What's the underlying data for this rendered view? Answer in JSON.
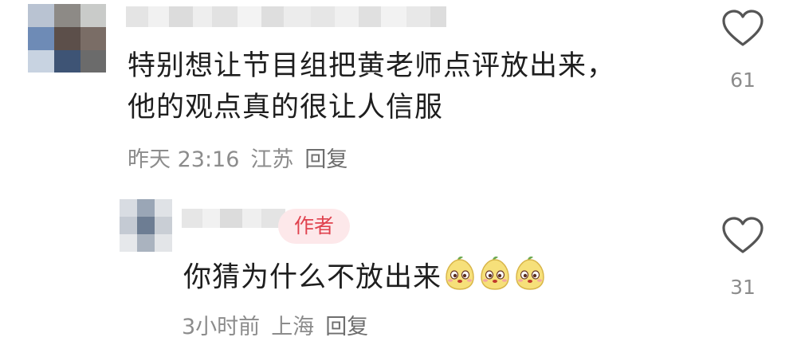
{
  "comments": [
    {
      "text_lines": [
        "特别想让节目组把黄老师点评放出来，",
        "他的观点真的很让人信服"
      ],
      "time": "昨天 23:16",
      "location": "江苏",
      "reply_label": "回复",
      "like_count": "61",
      "like_icon": "heart-outline-icon"
    },
    {
      "badge": "作者",
      "text": "你猜为什么不放出来",
      "emoji_icon": "pear-face-emoji",
      "emoji_count": 3,
      "time": "3小时前",
      "location": "上海",
      "reply_label": "回复",
      "like_count": "31",
      "like_icon": "heart-outline-icon"
    }
  ],
  "colors": {
    "text": "#1e1e1e",
    "meta": "#8c8c8c",
    "badge_bg": "#fde8ea",
    "badge_text": "#e0424e",
    "heart": "#555555"
  }
}
